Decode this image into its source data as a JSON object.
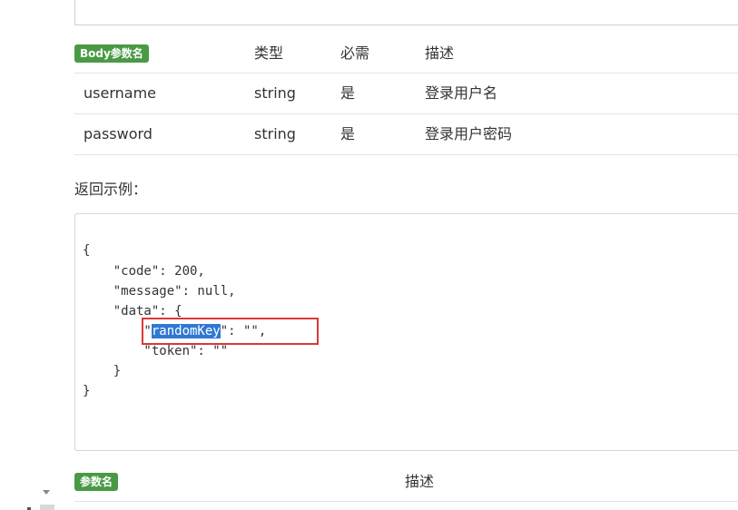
{
  "body_params": {
    "header": {
      "name": "Body参数名",
      "type": "类型",
      "required": "必需",
      "description": "描述"
    },
    "rows": [
      {
        "name": "username",
        "type": "string",
        "required": "是",
        "description": "登录用户名"
      },
      {
        "name": "password",
        "type": "string",
        "required": "是",
        "description": "登录用户密码"
      }
    ]
  },
  "response_example": {
    "title": "返回示例：",
    "lines": [
      "{",
      "    \"code\": 200,",
      "    \"message\": null,",
      "    \"data\": {",
      "        \"",
      "        \"token\": \"\"",
      "    }",
      "}"
    ],
    "selected_key": "randomKey",
    "selected_key_suffix": "\": \"\","
  },
  "params_table": {
    "header": {
      "name": "参数名",
      "description": "描述"
    }
  },
  "colors": {
    "badge": "#4a9a45",
    "selection": "#2f78d4",
    "highlight_border": "#d9383a"
  }
}
